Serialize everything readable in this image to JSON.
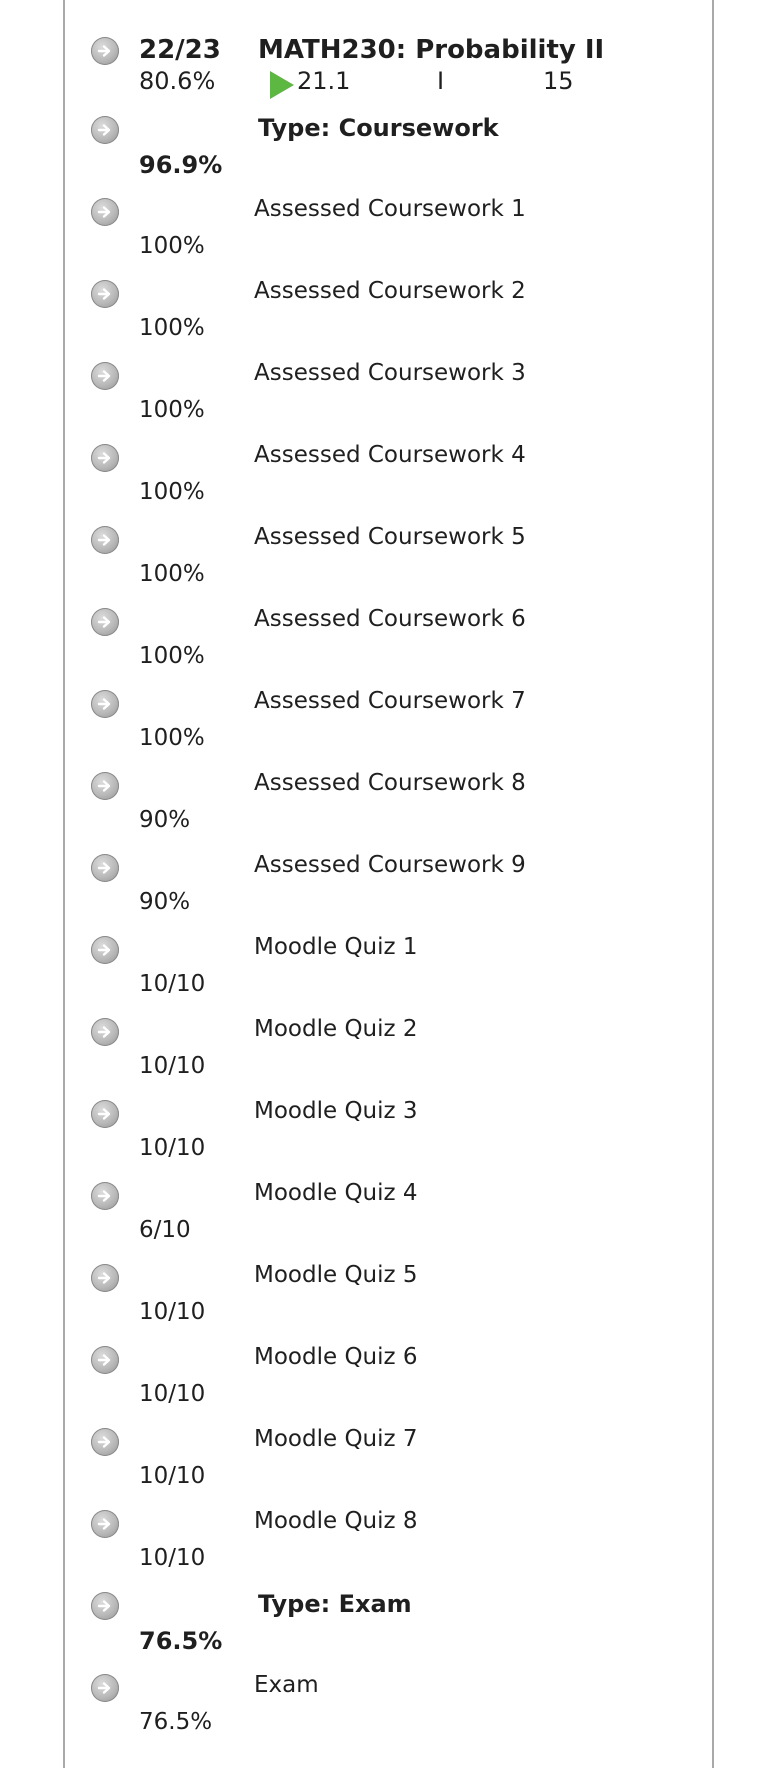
{
  "module": {
    "rank": "22/23",
    "title": "MATH230: Probability II",
    "percent": "80.6%",
    "value": "21.1",
    "code": "I",
    "credits": "15"
  },
  "rows": [
    {
      "label": "Type: Coursework",
      "score": "96.9%",
      "bold": true
    },
    {
      "label": "Assessed Coursework 1",
      "score": "100%",
      "bold": false
    },
    {
      "label": "Assessed Coursework 2",
      "score": "100%",
      "bold": false
    },
    {
      "label": "Assessed Coursework 3",
      "score": "100%",
      "bold": false
    },
    {
      "label": "Assessed Coursework 4",
      "score": "100%",
      "bold": false
    },
    {
      "label": "Assessed Coursework 5",
      "score": "100%",
      "bold": false
    },
    {
      "label": "Assessed Coursework 6",
      "score": "100%",
      "bold": false
    },
    {
      "label": "Assessed Coursework 7",
      "score": "100%",
      "bold": false
    },
    {
      "label": "Assessed Coursework 8",
      "score": "90%",
      "bold": false
    },
    {
      "label": "Assessed Coursework 9",
      "score": "90%",
      "bold": false
    },
    {
      "label": "Moodle Quiz 1",
      "score": "10/10",
      "bold": false
    },
    {
      "label": "Moodle Quiz 2",
      "score": "10/10",
      "bold": false
    },
    {
      "label": "Moodle Quiz 3",
      "score": "10/10",
      "bold": false
    },
    {
      "label": "Moodle Quiz 4",
      "score": "6/10",
      "bold": false
    },
    {
      "label": "Moodle Quiz 5",
      "score": "10/10",
      "bold": false
    },
    {
      "label": "Moodle Quiz 6",
      "score": "10/10",
      "bold": false
    },
    {
      "label": "Moodle Quiz 7",
      "score": "10/10",
      "bold": false
    },
    {
      "label": "Moodle Quiz 8",
      "score": "10/10",
      "bold": false
    },
    {
      "label": "Type: Exam",
      "score": "76.5%",
      "bold": true
    },
    {
      "label": "Exam",
      "score": "76.5%",
      "bold": false
    }
  ],
  "icons": {
    "row_arrow": "arrow-right-circle-icon",
    "play": "play-icon"
  },
  "colors": {
    "play": "#5cb840",
    "frame": "#a9a9a9"
  }
}
